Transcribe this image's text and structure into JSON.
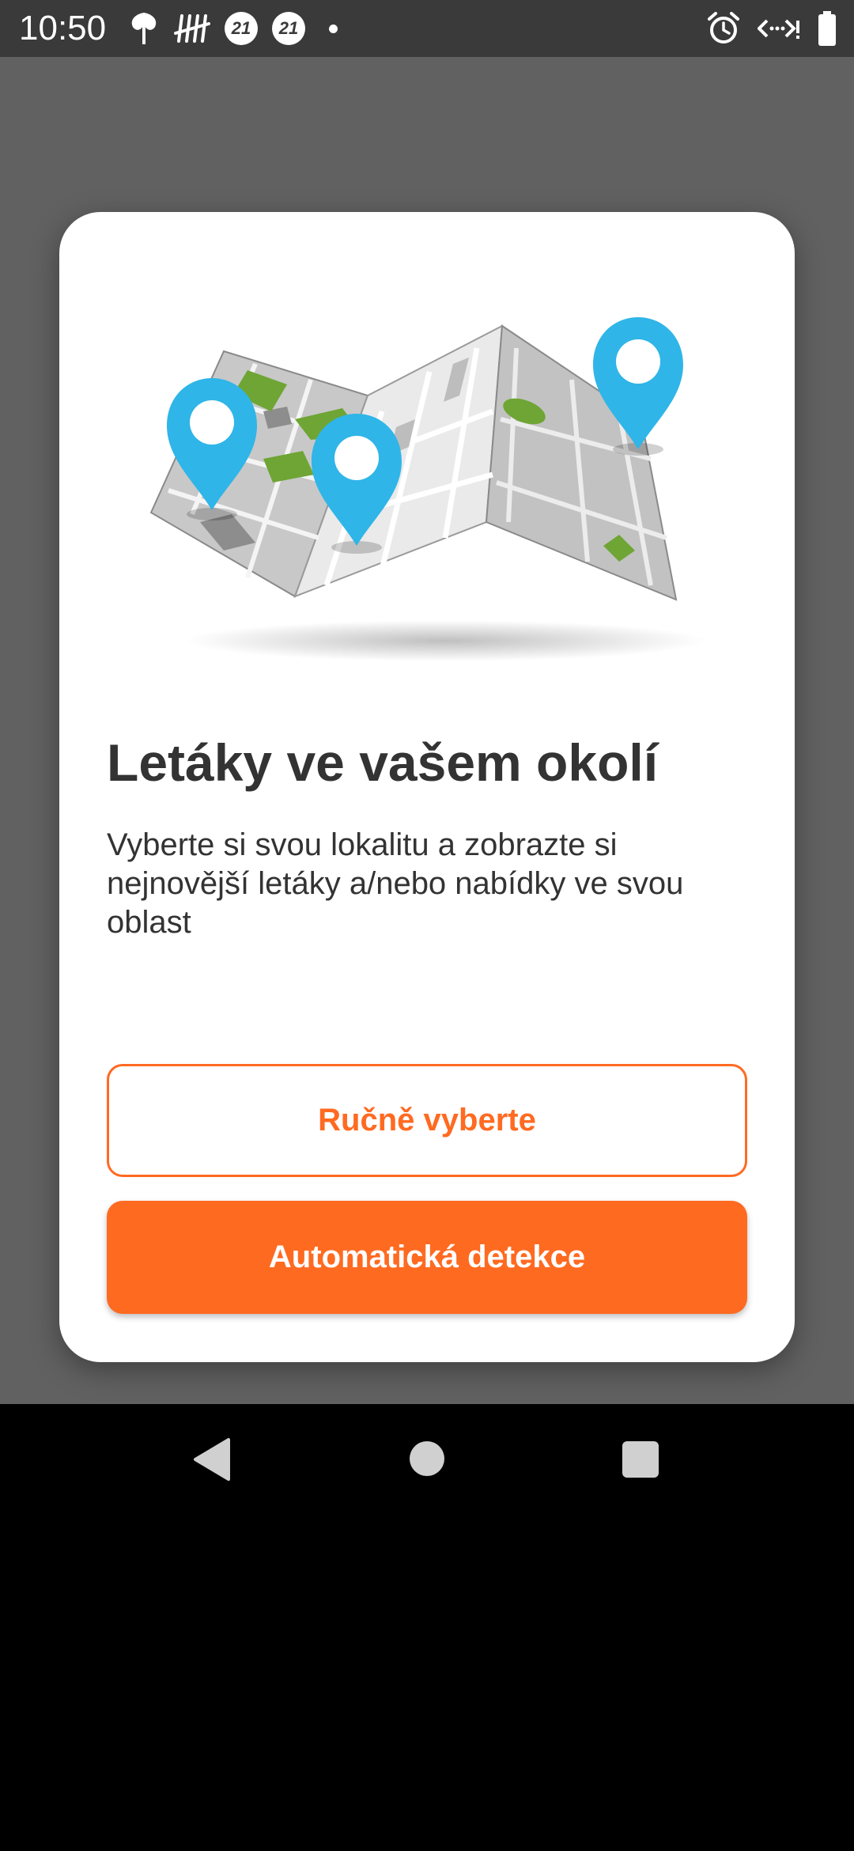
{
  "status_bar": {
    "time": "10:50",
    "left_icons": [
      "leaf-icon",
      "tally-icon",
      "badge-21-icon",
      "badge-21-icon",
      "dot-icon"
    ],
    "badge_text": "21",
    "right_icons": [
      "alarm-icon",
      "data-saver-icon",
      "battery-icon"
    ]
  },
  "card": {
    "illustration": "folded-map-with-location-pins",
    "title": "Letáky ve vašem okolí",
    "description": "Vyberte si svou lokalitu a zobrazte si nejnovější letáky a/nebo nabídky ve svou oblast",
    "manual_button_label": "Ručně vyberte",
    "auto_button_label": "Automatická detekce"
  },
  "colors": {
    "accent": "#ff6a21",
    "pin": "#2fb5e8",
    "overlay": "#616161",
    "map_green": "#6ea534"
  },
  "nav_bar": {
    "icons": [
      "back-icon",
      "home-icon",
      "recents-icon"
    ]
  }
}
